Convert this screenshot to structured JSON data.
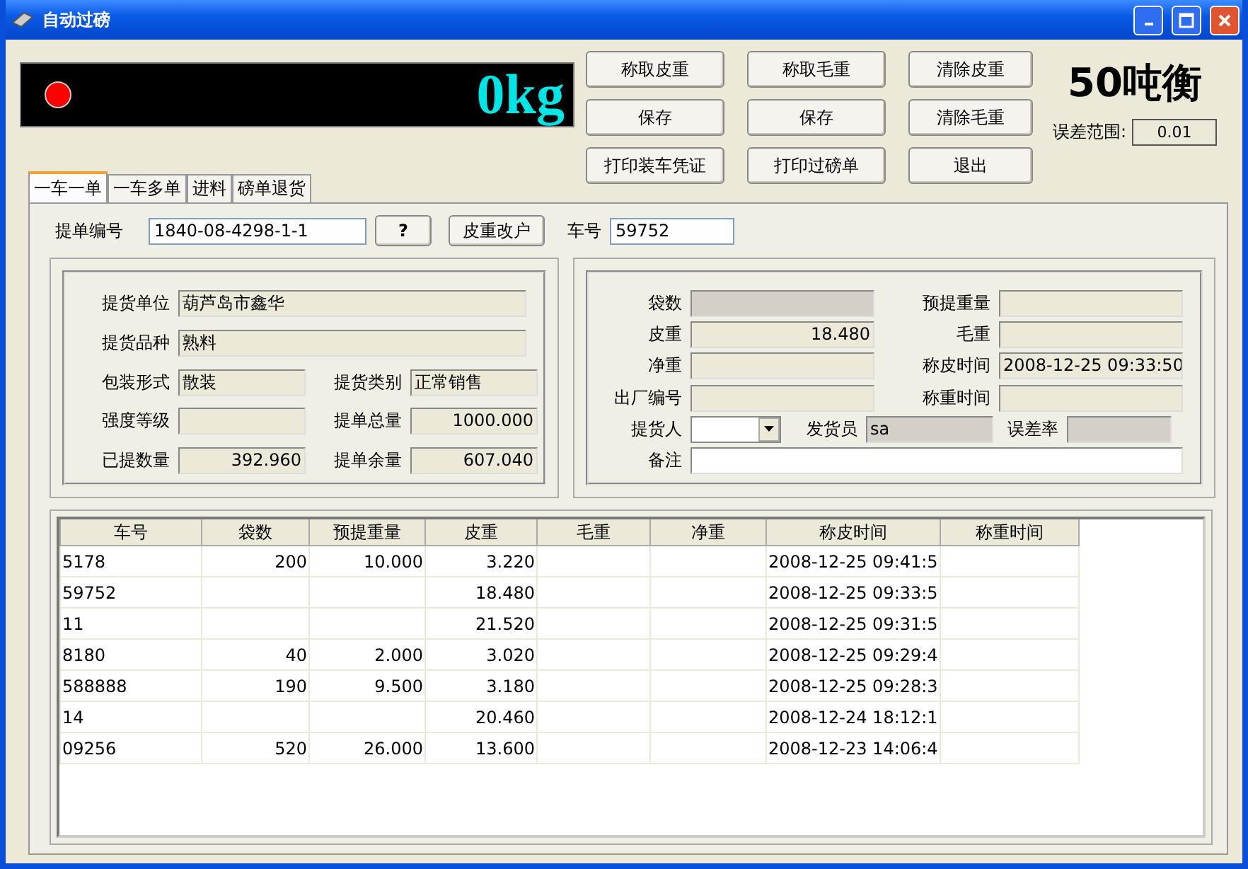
{
  "window": {
    "title": "自动过磅"
  },
  "display": {
    "reading": "0kg"
  },
  "buttons": [
    "称取皮重",
    "称取毛重",
    "清除皮重",
    "保存",
    "保存",
    "清除毛重",
    "打印装车凭证",
    "打印过磅单",
    "退出"
  ],
  "scale_name": "50吨衡",
  "tolerance": {
    "label": "误差范围:",
    "value": "0.01"
  },
  "tabs": [
    {
      "label": "一车一单",
      "selected": true
    },
    {
      "label": "一车多单",
      "selected": false
    },
    {
      "label": "进料",
      "selected": false
    },
    {
      "label": "磅单退货",
      "selected": false
    }
  ],
  "order_row": {
    "order_no_label": "提单编号",
    "order_no": "1840-08-4298-1-1",
    "help_button": "?",
    "change_button": "皮重改户",
    "plate_label": "车号",
    "plate": "59752"
  },
  "left_group": [
    [
      {
        "label": "提货单位",
        "value": "葫芦岛市鑫华",
        "kind": "readonly"
      }
    ],
    [
      {
        "label": "提货品种",
        "value": "熟料",
        "kind": "readonly"
      }
    ],
    [
      {
        "label": "包装形式",
        "value": "散装",
        "kind": "readonly"
      },
      {
        "label": "提货类别",
        "value": "正常销售",
        "kind": "readonly"
      }
    ],
    [
      {
        "label": "强度等级",
        "kind": "readonly"
      },
      {
        "label": "提单总量",
        "value": "1000.000",
        "kind": "number"
      }
    ],
    [
      {
        "label": "已提数量",
        "value": "392.960",
        "kind": "number"
      },
      {
        "label": "提单余量",
        "value": "607.040",
        "kind": "number"
      }
    ]
  ],
  "right_group": [
    [
      {
        "label": "袋数",
        "kind": "disabled"
      },
      {
        "label": "预提重量",
        "kind": "readonly"
      }
    ],
    [
      {
        "label": "皮重",
        "value": "18.480",
        "kind": "number"
      },
      {
        "label": "毛重",
        "kind": "readonly"
      }
    ],
    [
      {
        "label": "净重",
        "kind": "readonly"
      },
      {
        "label": "称皮时间",
        "value": "2008-12-25 09:33:50",
        "kind": "readonly"
      }
    ],
    [
      {
        "label": "出厂编号",
        "kind": "readonly"
      },
      {
        "label": "称重时间",
        "kind": "readonly"
      }
    ],
    [
      {
        "label": "提货人",
        "kind": "combo"
      },
      {
        "label": "发货员",
        "value": "sa",
        "kind": "disabled"
      },
      {
        "label": "误差率",
        "kind": "disabled"
      }
    ],
    [
      {
        "label": "备注",
        "kind": "input"
      }
    ]
  ],
  "table": {
    "columns": [
      "车号",
      "袋数",
      "预提重量",
      "皮重",
      "毛重",
      "净重",
      "称皮时间",
      "称重时间"
    ],
    "rows": [
      [
        "5178",
        "200",
        "10.000",
        "3.220",
        "",
        "",
        "2008-12-25 09:41:5",
        ""
      ],
      [
        "59752",
        "",
        "",
        "18.480",
        "",
        "",
        "2008-12-25 09:33:5",
        ""
      ],
      [
        "11",
        "",
        "",
        "21.520",
        "",
        "",
        "2008-12-25 09:31:5",
        ""
      ],
      [
        "8180",
        "40",
        "2.000",
        "3.020",
        "",
        "",
        "2008-12-25 09:29:4",
        ""
      ],
      [
        "588888",
        "190",
        "9.500",
        "3.180",
        "",
        "",
        "2008-12-25 09:28:3",
        ""
      ],
      [
        "14",
        "",
        "",
        "20.460",
        "",
        "",
        "2008-12-24 18:12:1",
        ""
      ],
      [
        "09256",
        "520",
        "26.000",
        "13.600",
        "",
        "",
        "2008-12-23 14:06:4",
        ""
      ]
    ]
  }
}
